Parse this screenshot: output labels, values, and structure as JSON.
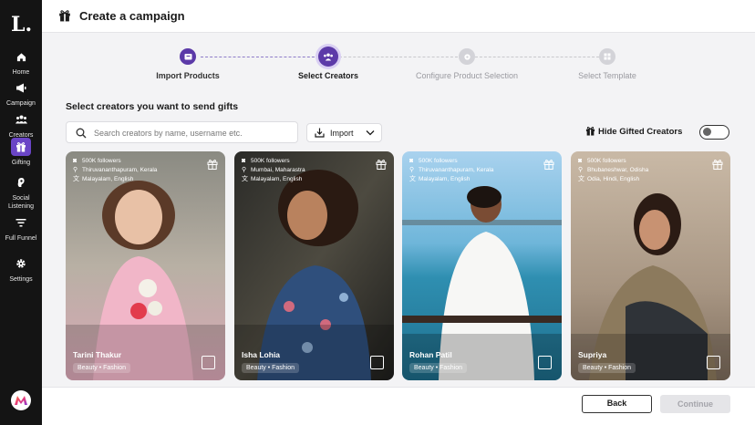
{
  "sidebar": {
    "logo": "L.",
    "items": [
      {
        "label": "Home",
        "icon": "home-icon"
      },
      {
        "label": "Campaign",
        "icon": "megaphone-icon"
      },
      {
        "label": "Creators",
        "icon": "users-icon"
      },
      {
        "label": "Gifting",
        "icon": "gift-icon",
        "active": true
      },
      {
        "label": "Social Listening",
        "icon": "ear-icon"
      },
      {
        "label": "Full Funnel",
        "icon": "funnel-icon"
      },
      {
        "label": "Settings",
        "icon": "gear-icon"
      }
    ],
    "accent": "#6a45c6"
  },
  "header": {
    "title": "Create a campaign"
  },
  "stepper": {
    "steps": [
      {
        "label": "Import Products",
        "state": "done"
      },
      {
        "label": "Select Creators",
        "state": "current"
      },
      {
        "label": "Configure Product Selection",
        "state": "pending"
      },
      {
        "label": "Select Template",
        "state": "pending"
      }
    ]
  },
  "section_title": "Select creators you want to send gifts",
  "search": {
    "placeholder": "Search creators by name, username etc.",
    "value": ""
  },
  "import_label": "Import",
  "hide_gifted_label": "Hide Gifted Creators",
  "hide_gifted_enabled": false,
  "creators": [
    {
      "name": "Tarini Thakur",
      "followers": "500K followers",
      "location": "Thiruvananthapuram, Kerala",
      "languages": "Malayalam, English",
      "category": "Beauty • Fashion"
    },
    {
      "name": "Isha Lohia",
      "followers": "500K followers",
      "location": "Mumbai, Maharastra",
      "languages": "Malayalam, English",
      "category": "Beauty • Fashion"
    },
    {
      "name": "Rohan Patil",
      "followers": "500K followers",
      "location": "Thiruvananthapuram, Kerala",
      "languages": "Malayalam, English",
      "category": "Beauty • Fashion"
    },
    {
      "name": "Supriya",
      "followers": "500K followers",
      "location": "Bhubaneshwar, Odisha",
      "languages": "Odia, Hindi, English",
      "category": "Beauty • Fashion"
    }
  ],
  "footer": {
    "back_label": "Back",
    "continue_label": "Continue"
  }
}
